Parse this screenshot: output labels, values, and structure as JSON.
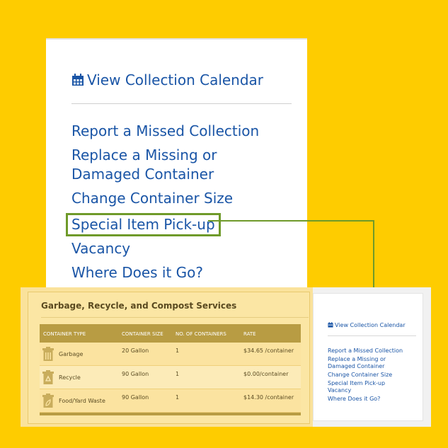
{
  "colors": {
    "background": "#FECC00",
    "link": "#1a55a6",
    "highlight_border": "#6f9a2a",
    "table_header": "#b89c43"
  },
  "zoom": {
    "calendar_icon": "calendar-icon",
    "calendar_link": "View Collection Calendar",
    "links": [
      "Report a Missed Collection",
      "Replace a Missing or Damaged Container",
      "Change Container Size",
      "Special Item Pick-up",
      "Vacancy",
      "Where Does it Go?"
    ]
  },
  "services": {
    "title": "Garbage, Recycle, and Compost Services",
    "columns": [
      "CONTAINER TYPE",
      "CONTAINER SIZE",
      "NO. OF CONTAINERS",
      "RATE"
    ],
    "rows": [
      {
        "icon": "trash-can-icon",
        "type": "Garbage",
        "size": "20 Gallon",
        "count": "1",
        "rate": "$34.65 /container"
      },
      {
        "icon": "recycle-bin-icon",
        "type": "Recycle",
        "size": "90 Gallon",
        "count": "1",
        "rate": "$0.00/container"
      },
      {
        "icon": "compost-bin-icon",
        "type": "Food/Yard Waste",
        "size": "90 Gallon",
        "count": "1",
        "rate": "$14.30 /container"
      }
    ]
  },
  "sidebar": {
    "calendar_link": "View Collection Calendar",
    "links": [
      "Report a Missed Collection",
      "Replace a Missing or Damaged Container",
      "Change Container Size",
      "Special Item Pick-up",
      "Vacancy",
      "Where Does it Go?"
    ]
  }
}
